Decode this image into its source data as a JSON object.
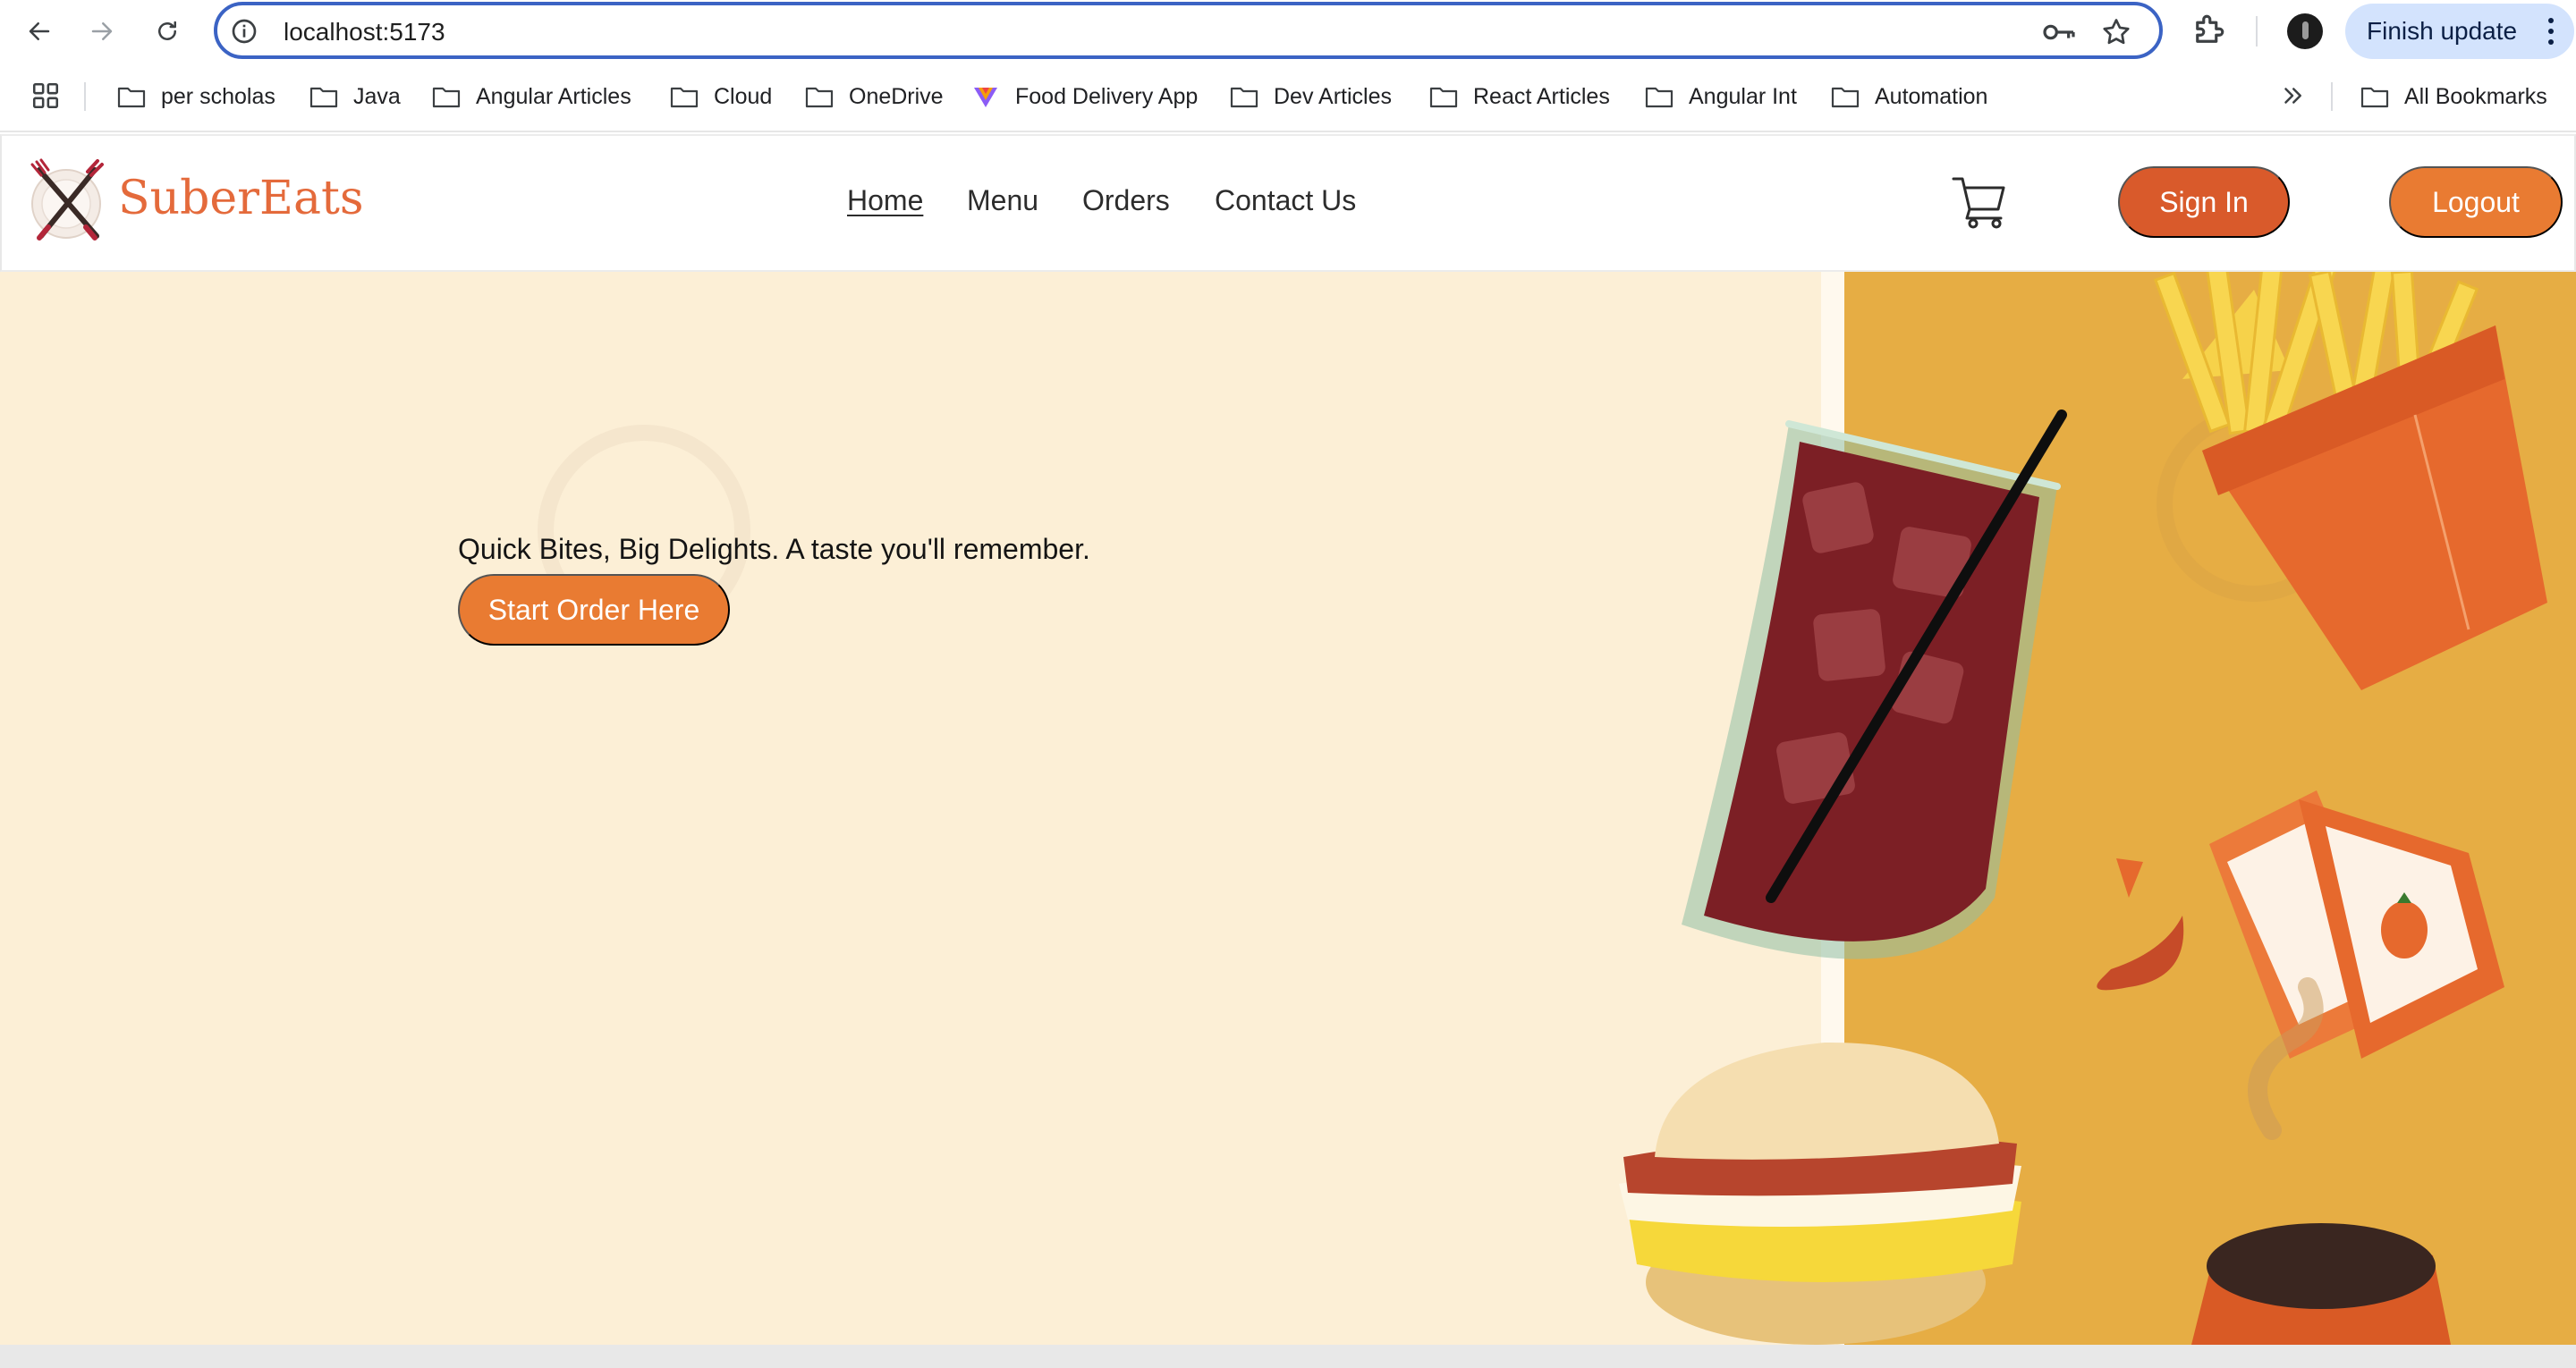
{
  "browser": {
    "url": "localhost:5173",
    "update_label": "Finish update",
    "bookmarks": [
      {
        "label": "per scholas"
      },
      {
        "label": "Java"
      },
      {
        "label": "Angular Articles"
      },
      {
        "label": "Cloud"
      },
      {
        "label": "OneDrive"
      },
      {
        "label": "Food Delivery App"
      },
      {
        "label": "Dev Articles"
      },
      {
        "label": "React Articles"
      },
      {
        "label": "Angular Int"
      },
      {
        "label": "Automation"
      }
    ],
    "all_bookmarks": "All Bookmarks"
  },
  "header": {
    "logo_text": "SuberEats",
    "nav": [
      {
        "label": "Home"
      },
      {
        "label": "Menu"
      },
      {
        "label": "Orders"
      },
      {
        "label": "Contact Us"
      }
    ],
    "sign_in": "Sign In",
    "logout": "Logout"
  },
  "hero": {
    "tagline": "Quick Bites, Big Delights. A taste you'll remember.",
    "cta": "Start Order Here"
  },
  "colors": {
    "brand": "#e46a3b",
    "sign_in_bg": "#d95a2b",
    "button_bg": "#e97b32",
    "hero_bg": "#fcefd6",
    "hero_accent": "#e6ad44",
    "focus_ring": "#3b63c4"
  }
}
